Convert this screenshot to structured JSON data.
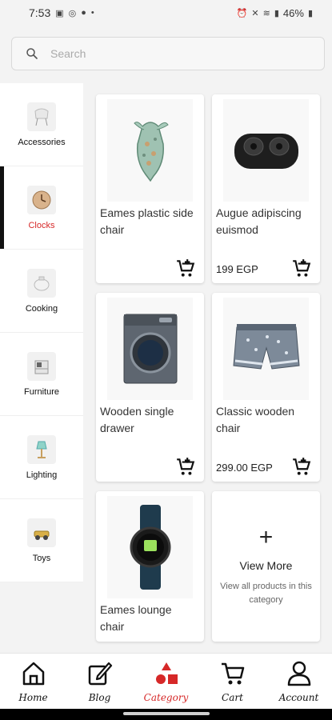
{
  "status": {
    "time": "7:53",
    "battery": "46%",
    "left_glyphs": [
      "photo-icon",
      "whatsapp-icon",
      "facebook-icon",
      "dot"
    ],
    "right_glyphs": [
      "alarm-icon",
      "mute-icon",
      "volte-icon",
      "signal-icon"
    ]
  },
  "search": {
    "placeholder": "Search"
  },
  "categories": [
    {
      "label": "Accessories",
      "icon": "chair-icon"
    },
    {
      "label": "Clocks",
      "icon": "clock-icon",
      "active": true
    },
    {
      "label": "Cooking",
      "icon": "pot-icon"
    },
    {
      "label": "Furniture",
      "icon": "cabinet-icon"
    },
    {
      "label": "Lighting",
      "icon": "lamp-icon"
    },
    {
      "label": "Toys",
      "icon": "toy-icon"
    }
  ],
  "products": [
    {
      "name": "Eames plastic side chair",
      "price": "",
      "image": "scarf-image"
    },
    {
      "name": "Augue adipiscing euismod",
      "price": "199 EGP",
      "image": "earbuds-image"
    },
    {
      "name": "Wooden single drawer",
      "price": "",
      "image": "washing-machine-image"
    },
    {
      "name": "Classic wooden chair",
      "price": "299.00 EGP",
      "image": "shorts-image"
    },
    {
      "name": "Eames lounge chair",
      "price": "",
      "image": "smartwatch-image"
    }
  ],
  "view_more": {
    "plus": "+",
    "title": "View More",
    "subtitle": "View all products in this category"
  },
  "nav": [
    {
      "label": "Home",
      "icon": "home-icon"
    },
    {
      "label": "Blog",
      "icon": "blog-icon"
    },
    {
      "label": "Category",
      "icon": "category-icon",
      "active": true
    },
    {
      "label": "Cart",
      "icon": "cart-icon"
    },
    {
      "label": "Account",
      "icon": "account-icon"
    }
  ],
  "colors": {
    "accent": "#d62828",
    "active_indicator": "#111111",
    "background": "#f3f3f3"
  }
}
